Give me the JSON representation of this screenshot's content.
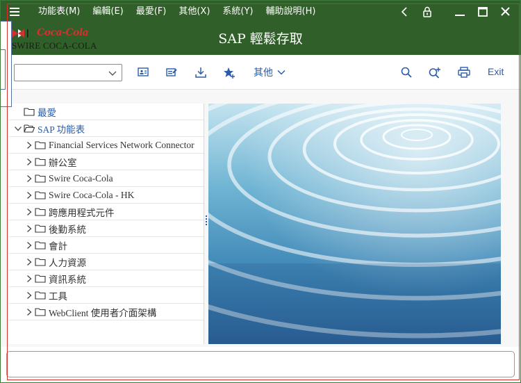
{
  "menu": {
    "items": [
      "功能表(M)",
      "編輯(E)",
      "最愛(F)",
      "其他(X)",
      "系統(Y)",
      "輔助說明(H)"
    ]
  },
  "window_controls": {
    "icons": [
      "back-icon",
      "lock-icon",
      "minimize-icon",
      "maximize-icon",
      "close-icon"
    ]
  },
  "header": {
    "title": "SAP 輕鬆存取",
    "logo_script": "Coca-Cola",
    "logo_text": "SWIRE COCA-COLA"
  },
  "toolbar": {
    "command_field_value": "",
    "more_label": "其他",
    "exit_label": "Exit",
    "icons": [
      "user-menu-icon",
      "sap-menu-icon",
      "download-icon",
      "add-favorite-icon",
      "search-icon",
      "search-next-icon",
      "print-icon"
    ]
  },
  "tree": {
    "items": [
      {
        "label": "最愛",
        "expander": "none",
        "level": 0
      },
      {
        "label": "SAP 功能表",
        "expander": "expanded",
        "level": 0
      },
      {
        "label": "Financial Services Network Connector",
        "expander": "collapsed",
        "level": 1
      },
      {
        "label": "辦公室",
        "expander": "collapsed",
        "level": 1
      },
      {
        "label": "Swire Coca-Cola",
        "expander": "collapsed",
        "level": 1
      },
      {
        "label": "Swire Coca-Cola - HK",
        "expander": "collapsed",
        "level": 1
      },
      {
        "label": "跨應用程式元件",
        "expander": "collapsed",
        "level": 1
      },
      {
        "label": "後勤系統",
        "expander": "collapsed",
        "level": 1
      },
      {
        "label": "會計",
        "expander": "collapsed",
        "level": 1
      },
      {
        "label": "人力資源",
        "expander": "collapsed",
        "level": 1
      },
      {
        "label": "資訊系統",
        "expander": "collapsed",
        "level": 1
      },
      {
        "label": "工具",
        "expander": "collapsed",
        "level": 1
      },
      {
        "label": "WebClient 使用者介面架構",
        "expander": "collapsed",
        "level": 1
      }
    ]
  },
  "colors": {
    "header_green": "#315f29",
    "link_blue": "#2a5caa",
    "brand_red": "#d3302f"
  }
}
